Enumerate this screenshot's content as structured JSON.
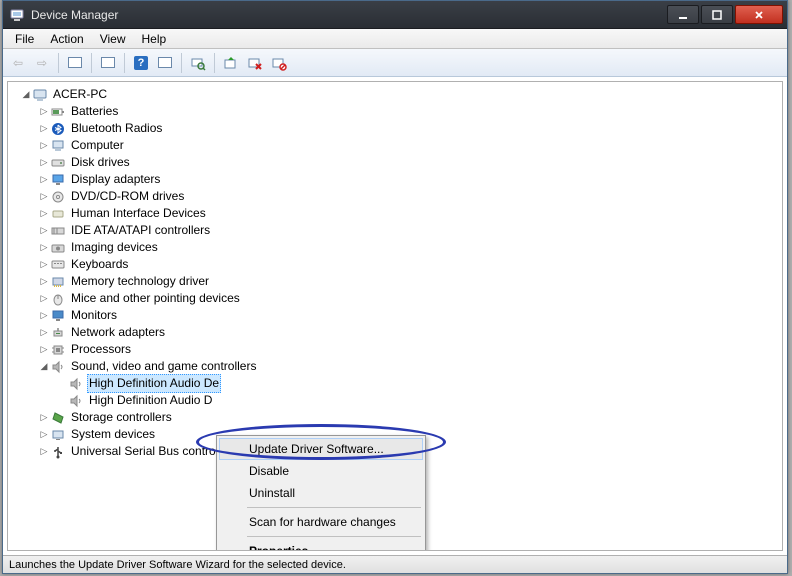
{
  "window": {
    "title": "Device Manager"
  },
  "menu": {
    "file": "File",
    "action": "Action",
    "view": "View",
    "help": "Help"
  },
  "tree": {
    "root": "ACER-PC",
    "items": [
      "Batteries",
      "Bluetooth Radios",
      "Computer",
      "Disk drives",
      "Display adapters",
      "DVD/CD-ROM drives",
      "Human Interface Devices",
      "IDE ATA/ATAPI controllers",
      "Imaging devices",
      "Keyboards",
      "Memory technology driver",
      "Mice and other pointing devices",
      "Monitors",
      "Network adapters",
      "Processors",
      "Sound, video and game controllers",
      "Storage controllers",
      "System devices",
      "Universal Serial Bus controll"
    ],
    "sound_children": [
      "High Definition Audio De",
      "High Definition Audio D"
    ]
  },
  "context_menu": {
    "update": "Update Driver Software...",
    "disable": "Disable",
    "uninstall": "Uninstall",
    "scan": "Scan for hardware changes",
    "properties": "Properties"
  },
  "statusbar": {
    "text": "Launches the Update Driver Software Wizard for the selected device."
  }
}
